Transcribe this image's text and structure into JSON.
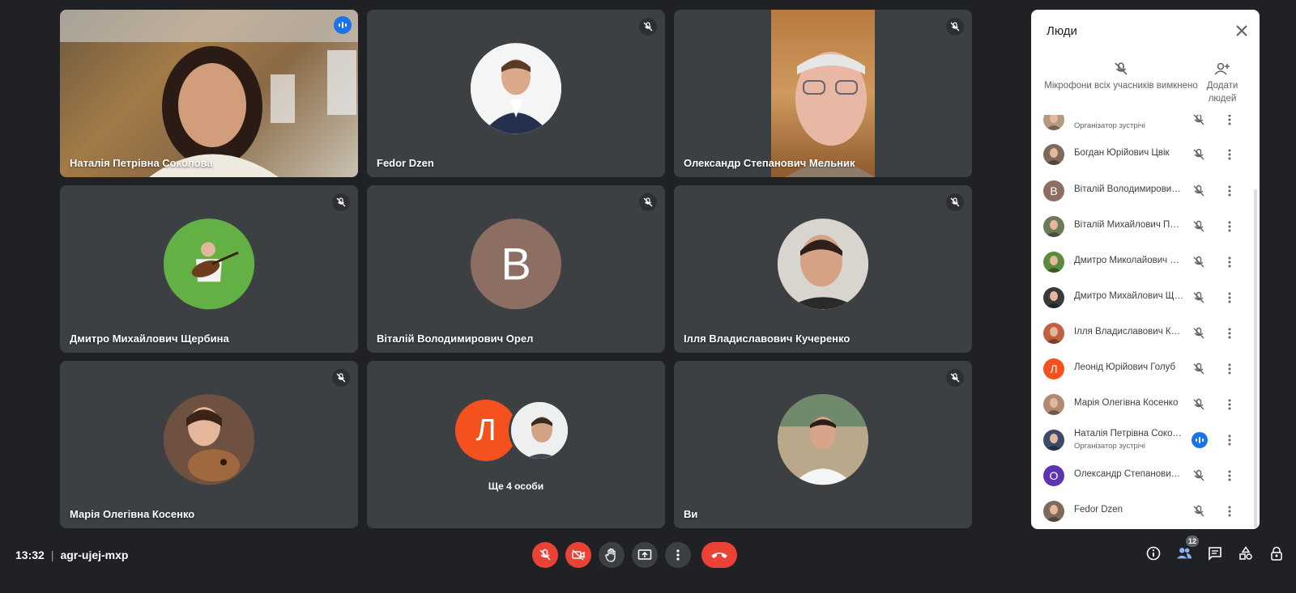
{
  "meeting": {
    "time": "13:32",
    "separator": "|",
    "code": "agr-ujej-mxp"
  },
  "tiles": [
    {
      "name": "Наталія Петрівна Соколова",
      "type": "video",
      "state": "speaking"
    },
    {
      "name": "Fedor Dzen",
      "type": "avatar",
      "state": "muted"
    },
    {
      "name": "Олександр Степанович Мельник",
      "type": "video",
      "state": "muted"
    },
    {
      "name": "Дмитро Михайлович Щербина",
      "type": "avatar",
      "state": "muted"
    },
    {
      "name": "Віталій Володимирович Орел",
      "type": "initial",
      "initial": "В",
      "color": "#8d6e63",
      "state": "muted"
    },
    {
      "name": "Ілля Владиславович Кучеренко",
      "type": "avatar",
      "state": "muted"
    },
    {
      "name": "Марія Олегівна Косенко",
      "type": "avatar",
      "state": "muted"
    },
    {
      "name": "",
      "type": "more",
      "initial": "Л",
      "label": "Ще 4 особи"
    },
    {
      "name": "Ви",
      "type": "avatar",
      "state": "muted"
    }
  ],
  "panel": {
    "title": "Люди",
    "mute_all_label": "Мікрофони всіх учасників вимкнено",
    "add_people_label": "Додати людей",
    "participants": [
      {
        "name": "",
        "sub": "Організатор зустрічі",
        "avatar": "photo",
        "state": "muted",
        "partial": true
      },
      {
        "name": "Богдан Юрійович Цвік",
        "avatar": "photo",
        "state": "muted"
      },
      {
        "name": "Віталій Володимирович Орел",
        "avatar": "initial",
        "initial": "В",
        "color": "#8d6e63",
        "state": "muted"
      },
      {
        "name": "Віталій Михайлович Поспєлов",
        "avatar": "photo",
        "state": "muted"
      },
      {
        "name": "Дмитро Миколайович Чорний",
        "avatar": "photo",
        "state": "muted"
      },
      {
        "name": "Дмитро Михайлович Щербина",
        "avatar": "photo",
        "state": "muted"
      },
      {
        "name": "Ілля Владиславович Кучеренко",
        "avatar": "photo",
        "state": "muted"
      },
      {
        "name": "Леонід Юрійович Голуб",
        "avatar": "initial",
        "initial": "Л",
        "color": "#f4511e",
        "state": "muted"
      },
      {
        "name": "Марія Олегівна Косенко",
        "avatar": "photo",
        "state": "muted"
      },
      {
        "name": "Наталія Петрівна Соколова",
        "sub": "Організатор зустрічі",
        "avatar": "photo",
        "state": "speaking"
      },
      {
        "name": "Олександр Степанович Мельник",
        "avatar": "initial",
        "initial": "О",
        "color": "#5e35b1",
        "state": "muted"
      },
      {
        "name": "Fedor Dzen",
        "avatar": "photo",
        "state": "muted"
      }
    ]
  },
  "toolbar": {
    "people_count": "12"
  },
  "colors": {
    "accent": "#1a73e8",
    "danger": "#ea4335",
    "tile_bg": "#3c4043",
    "bg": "#202124"
  }
}
